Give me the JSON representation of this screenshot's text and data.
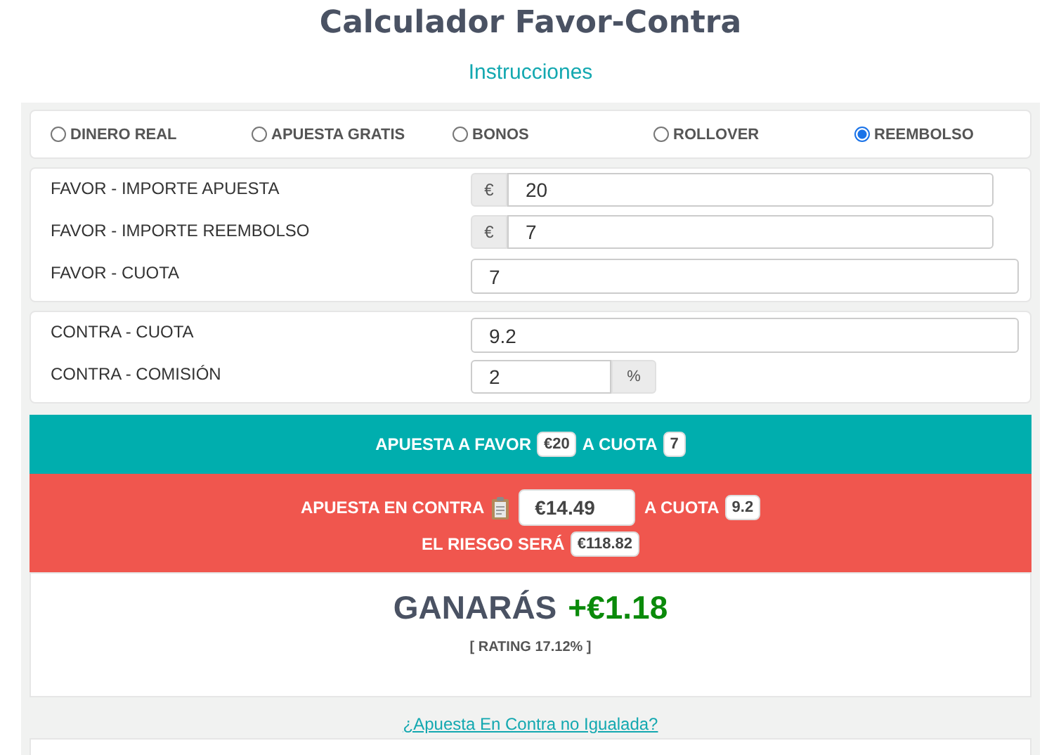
{
  "title": "Calculador Favor-Contra",
  "instructions_link": "Instrucciones",
  "bet_types": [
    {
      "label": "DINERO REAL",
      "selected": false
    },
    {
      "label": "APUESTA GRATIS",
      "selected": false
    },
    {
      "label": "BONOS",
      "selected": false
    },
    {
      "label": "ROLLOVER",
      "selected": false
    },
    {
      "label": "REEMBOLSO",
      "selected": true
    }
  ],
  "favor_fields": [
    {
      "label": "FAVOR - IMPORTE APUESTA",
      "kind": "prefix",
      "addon": "€",
      "value": "20"
    },
    {
      "label": "FAVOR - IMPORTE REEMBOLSO",
      "kind": "prefix",
      "addon": "€",
      "value": "7"
    },
    {
      "label": "FAVOR - CUOTA",
      "kind": "plain",
      "value": "7"
    }
  ],
  "contra_fields": [
    {
      "label": "CONTRA - CUOTA",
      "kind": "plain",
      "value": "9.2"
    },
    {
      "label": "CONTRA - COMISIÓN",
      "kind": "suffix",
      "addon": "%",
      "value": "2"
    }
  ],
  "favor_result": {
    "label": "APUESTA A FAVOR",
    "amount": "€20",
    "odds_label": "A CUOTA",
    "odds": "7"
  },
  "contra_result": {
    "label": "APUESTA EN CONTRA",
    "amount": "€14.49",
    "odds_label": "A CUOTA",
    "odds": "9.2"
  },
  "risk": {
    "label": "EL RIESGO SERÁ",
    "amount": "€118.82"
  },
  "profit": {
    "label": "GANARÁS",
    "amount": "+€1.18"
  },
  "rating": "[ RATING 17.12% ]",
  "unmatched_link": "¿Apuesta En Contra no Igualada?"
}
